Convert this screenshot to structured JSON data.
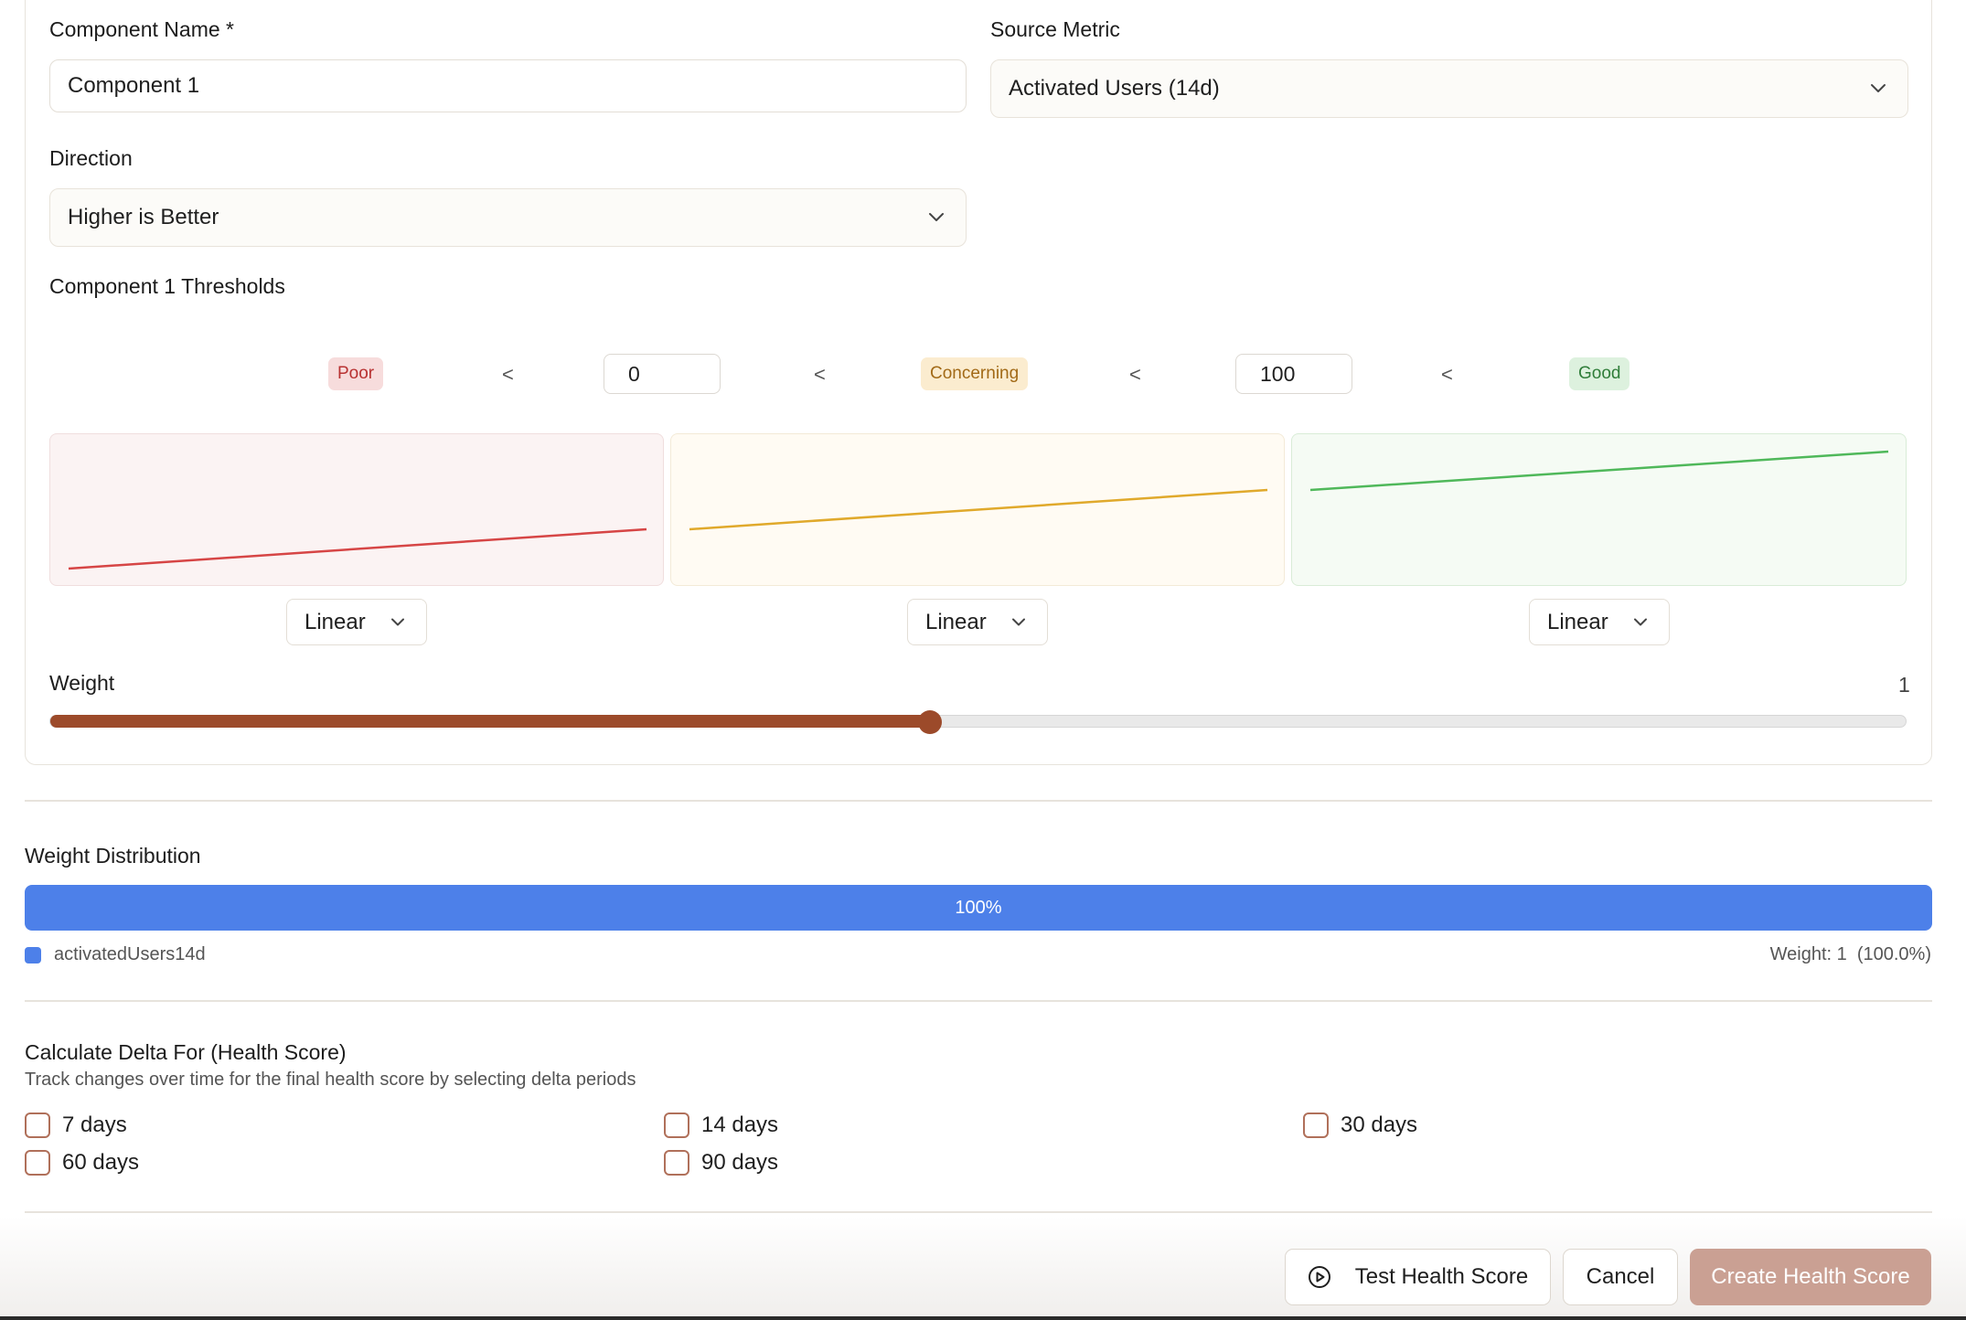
{
  "component": {
    "name_label": "Component Name *",
    "name_value": "Component 1",
    "source_metric_label": "Source Metric",
    "source_metric_value": "Activated Users (14d)",
    "direction_label": "Direction",
    "direction_value": "Higher is Better",
    "thresholds_title": "Component 1 Thresholds",
    "thresholds": {
      "poor_label": "Poor",
      "concerning_label": "Concerning",
      "good_label": "Good",
      "lt_symbol": "<",
      "lower_value": "0",
      "upper_value": "100"
    },
    "curves": [
      {
        "id": "poor",
        "type": "Linear",
        "color": "#d64545"
      },
      {
        "id": "concerning",
        "type": "Linear",
        "color": "#e0a92b"
      },
      {
        "id": "good",
        "type": "Linear",
        "color": "#4fb85a"
      }
    ],
    "weight_label": "Weight",
    "weight_value": "1",
    "weight_slider_fraction": 0.474
  },
  "weight_distribution": {
    "title": "Weight Distribution",
    "bar_label": "100%",
    "bar_color": "#4d80e9",
    "legend_name": "activatedUsers14d",
    "legend_weight": "Weight: 1  (100.0%)"
  },
  "delta": {
    "title": "Calculate Delta For (Health Score)",
    "description": "Track changes over time for the final health score by selecting delta periods",
    "options": [
      "7 days",
      "14 days",
      "30 days",
      "60 days",
      "90 days"
    ]
  },
  "actions": {
    "test_label": "Test Health Score",
    "cancel_label": "Cancel",
    "create_label": "Create Health Score",
    "primary_color": "#caa093",
    "slider_color": "#9c4a2a"
  },
  "icons": {
    "chevron": "chevron-down-icon",
    "play": "play-circle-icon"
  }
}
